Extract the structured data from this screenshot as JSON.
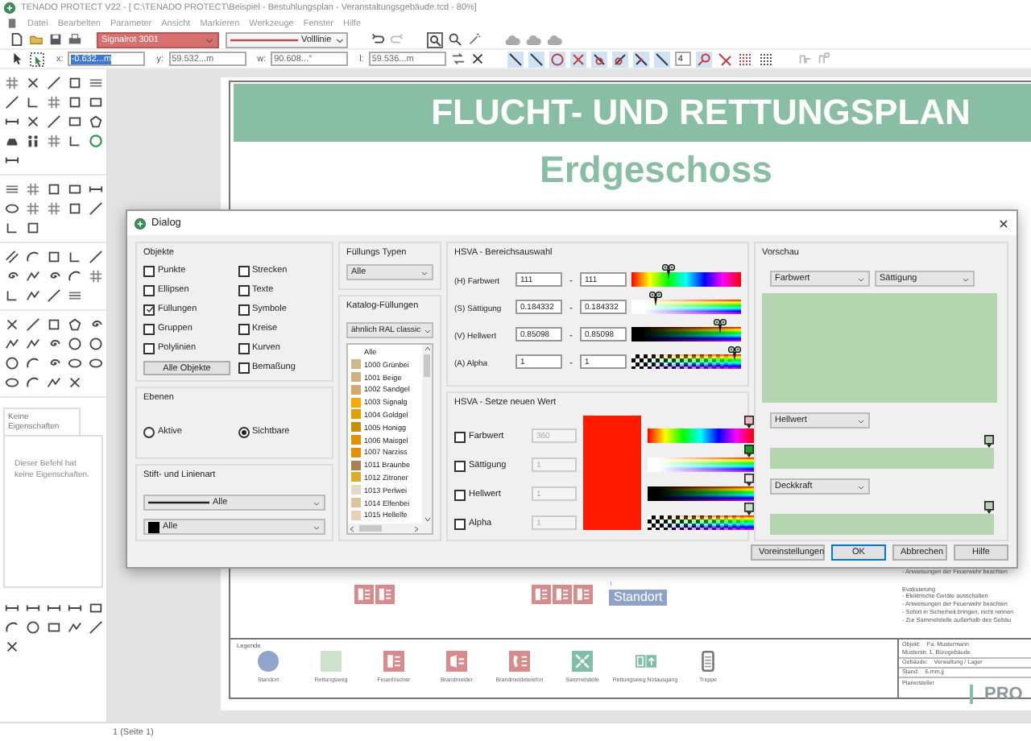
{
  "window": {
    "title": "TENADO PROTECT V22 - [ C:\\TENADO PROTECT\\Beispiel - Bestuhlungsplan - Veranstaltungsgebäude.tcd - 80%]"
  },
  "menu": [
    {
      "label": "Datei"
    },
    {
      "label": "Bearbeiten"
    },
    {
      "label": "Parameter"
    },
    {
      "label": "Ansicht"
    },
    {
      "label": "Markieren"
    },
    {
      "label": "Werkzeuge"
    },
    {
      "label": "Fenster"
    },
    {
      "label": "Hilfe"
    }
  ],
  "toolbar": {
    "color_name": "Signalrot 3001",
    "line_style": "Volllinie",
    "snap_value": "4"
  },
  "coordinates": [
    {
      "label": "x:",
      "value": "-0.632...m",
      "selected": true
    },
    {
      "label": "y:",
      "value": "59.532...m",
      "selected": false
    },
    {
      "label": "w:",
      "value": "90.608...°",
      "selected": false
    },
    {
      "label": "l:",
      "value": "59.536...m",
      "selected": false
    }
  ],
  "properties": {
    "tab": "Keine Eigenschaften",
    "message": "Dieser Befehl hat keine Eigenschaften."
  },
  "plan": {
    "title": "FLUCHT- UND RETTUNGSPLAN",
    "subtitle": "Erdgeschoss",
    "location_label": "Standort",
    "notes": [
      "- Anweisungen der Feuerwehr beachten",
      "Evakuierung",
      "- Elektrische Geräte ausschalten",
      "- Anweisungen der Feuerwehr beachten",
      "- Sofort in Sicherheit bringen, nicht rennen",
      "- Zur Sammelstelle außerhalb des Gebäu"
    ],
    "legend": {
      "title": "Legende",
      "items": [
        {
          "label": "Standort",
          "kind": "dot"
        },
        {
          "label": "Rettungsweg",
          "kind": "area"
        },
        {
          "label": "Feuerlöscher",
          "kind": "fire-extinguisher"
        },
        {
          "label": "Brandmelder",
          "kind": "fire-alarm"
        },
        {
          "label": "Brandmeldetelefon",
          "kind": "fire-phone"
        },
        {
          "label": "Sammelstelle",
          "kind": "assembly-point"
        },
        {
          "label": "Rettungsweg Notausgang",
          "kind": "exit"
        },
        {
          "label": "Treppe",
          "kind": "stairs"
        }
      ]
    },
    "title_block": [
      {
        "label": "Objekt:",
        "value": "Fa. Mustermann"
      },
      {
        "value": "Musterstr. 1, Bürogebäude"
      },
      {
        "label": "Gebäude:",
        "value": "Verwaltung / Lager"
      },
      {
        "label": "Stand:",
        "value": "6.mm.jj"
      },
      {
        "label": "Planersteller",
        "value": "PRO"
      }
    ]
  },
  "dialog": {
    "title": "Dialog",
    "objects": {
      "label": "Objekte",
      "items": [
        {
          "kind": "checkbox",
          "label": "Punkte",
          "checked": false
        },
        {
          "kind": "checkbox",
          "label": "Strecken",
          "checked": false
        },
        {
          "kind": "checkbox",
          "label": "Ellipsen",
          "checked": false
        },
        {
          "kind": "checkbox",
          "label": "Texte",
          "checked": false
        },
        {
          "kind": "checkbox",
          "label": "Füllungen",
          "checked": true
        },
        {
          "kind": "checkbox",
          "label": "Symbole",
          "checked": false
        },
        {
          "kind": "checkbox",
          "label": "Gruppen",
          "checked": false
        },
        {
          "kind": "checkbox",
          "label": "Kreise",
          "checked": false
        },
        {
          "kind": "checkbox",
          "label": "Polylinien",
          "checked": false
        },
        {
          "kind": "checkbox",
          "label": "Kurven",
          "checked": false
        },
        {
          "kind": "button",
          "label": "Alle Objekte"
        },
        {
          "kind": "checkbox",
          "label": "Bemaßung",
          "checked": false
        }
      ]
    },
    "layers": {
      "label": "Ebenen",
      "options": [
        {
          "label": "Aktive",
          "selected": false
        },
        {
          "label": "Sichtbare",
          "selected": true
        }
      ]
    },
    "pen": {
      "label": "Stift- und Linienart",
      "line": "Alle",
      "color_label": "Alle"
    },
    "fill_types": {
      "label": "Füllungs Typen",
      "value": "Alle"
    },
    "catalog": {
      "label": "Katalog-Füllungen",
      "value": "ähnlich RAL classic",
      "items": [
        {
          "label": "Alle"
        },
        {
          "label": "1000 Grünbei",
          "color": "#cdba88"
        },
        {
          "label": "1001 Beige",
          "color": "#d0b084"
        },
        {
          "label": "1002 Sandgel",
          "color": "#d2aa6d"
        },
        {
          "label": "1003 Signalg",
          "color": "#f9a800"
        },
        {
          "label": "1004 Goldgel",
          "color": "#e49e00"
        },
        {
          "label": "1005 Honigg",
          "color": "#cb8e00"
        },
        {
          "label": "1006 Maisgel",
          "color": "#e29000"
        },
        {
          "label": "1007 Narziss",
          "color": "#e88c00"
        },
        {
          "label": "1011 Braunbe",
          "color": "#af804f"
        },
        {
          "label": "1012 Zitroner",
          "color": "#ddaf27"
        },
        {
          "label": "1013 Perlwei",
          "color": "#e3d9c6"
        },
        {
          "label": "1014 Elfenbei",
          "color": "#ddc49a"
        },
        {
          "label": "1015 Hellelfe",
          "color": "#e6d2b5"
        }
      ]
    },
    "range": {
      "label": "HSVA - Bereichsauswahl",
      "rows": [
        {
          "label": "(H) Farbwert",
          "from": "111",
          "separator": "-",
          "to": "111",
          "kind": "hue",
          "level": 0.31
        },
        {
          "label": "(S) Sättigung",
          "from": "0.184332",
          "separator": "-",
          "to": "0.184332",
          "kind": "saturation",
          "level": 0.18
        },
        {
          "label": "(V) Hellwert",
          "from": "0.85098",
          "separator": "-",
          "to": "0.85098",
          "kind": "value",
          "level": 0.85
        },
        {
          "label": "(A) Alpha",
          "from": "1",
          "separator": "-",
          "to": "1",
          "kind": "alpha",
          "level": 1
        }
      ]
    },
    "set_value": {
      "label": "HSVA - Setze neuen Wert",
      "color": "#ff1a00",
      "rows": [
        {
          "label": "Farbwert",
          "checked": false,
          "value": "360",
          "kind": "hue",
          "level": 1,
          "color": "#f2b8c0"
        },
        {
          "label": "Sättigung",
          "checked": false,
          "value": "1",
          "kind": "saturation",
          "level": 1,
          "color": "#1aa01a"
        },
        {
          "label": "Hellwert",
          "checked": false,
          "value": "1",
          "kind": "value",
          "level": 1,
          "color": "#e8e8e8"
        },
        {
          "label": "Alpha",
          "checked": false,
          "value": "1",
          "kind": "alpha",
          "level": 1,
          "color": "#c8e0c0"
        }
      ]
    },
    "preview": {
      "label": "Vorschau",
      "axis_x": "Farbwert",
      "axis_y": "Sättigung",
      "color": "#b5d4b0",
      "sliders": [
        {
          "label": "Hellwert",
          "level": 1
        },
        {
          "label": "Deckkraft",
          "level": 1
        }
      ]
    },
    "buttons": [
      {
        "label": "Voreinstellungen",
        "default": false
      },
      {
        "label": "OK",
        "default": true
      },
      {
        "label": "Abbrechen",
        "default": false
      },
      {
        "label": "Hilfe",
        "default": false
      }
    ]
  },
  "status_bar": {
    "page": "1 (Seite 1)"
  }
}
